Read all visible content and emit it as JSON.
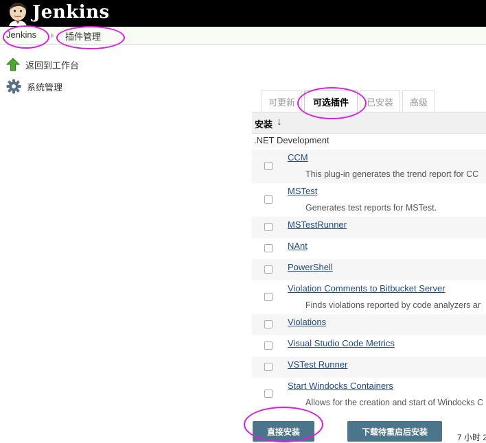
{
  "header": {
    "brand": "Jenkins",
    "logo_icon": "jenkins-butler-icon"
  },
  "breadcrumb": {
    "home": "Jenkins",
    "current": "插件管理"
  },
  "sidebar": {
    "items": [
      {
        "label": "返回到工作台",
        "icon": "green-up-arrow-icon"
      },
      {
        "label": "系统管理",
        "icon": "gear-icon"
      }
    ]
  },
  "tabs": [
    {
      "label": "可更新",
      "active": false
    },
    {
      "label": "可选插件",
      "active": true
    },
    {
      "label": "已安装",
      "active": false
    },
    {
      "label": "高级",
      "active": false
    }
  ],
  "table": {
    "header_install": "安装",
    "sort_indicator": "↓",
    "category": ".NET Development",
    "plugins": [
      {
        "name": "CCM",
        "description": "This plug-in generates the trend report for CC"
      },
      {
        "name": "MSTest",
        "description": "Generates test reports for MSTest."
      },
      {
        "name": "MSTestRunner",
        "description": ""
      },
      {
        "name": "NAnt",
        "description": ""
      },
      {
        "name": "PowerShell",
        "description": ""
      },
      {
        "name": "Violation Comments to Bitbucket Server",
        "description": "Finds violations reported by code analyzers ar"
      },
      {
        "name": "Violations",
        "description": ""
      },
      {
        "name": "Visual Studio Code Metrics",
        "description": ""
      },
      {
        "name": "VSTest Runner",
        "description": ""
      },
      {
        "name": "Start Windocks Containers",
        "description": "Allows for the creation and start of Windocks C"
      }
    ]
  },
  "actions": {
    "install_now": "直接安装",
    "install_after_restart": "下载待重启后安装"
  },
  "status": {
    "time_text": "7 小时 2"
  },
  "colors": {
    "annotation_ring": "#e01be6",
    "button_bg": "#4b758b",
    "link": "#204a87"
  }
}
